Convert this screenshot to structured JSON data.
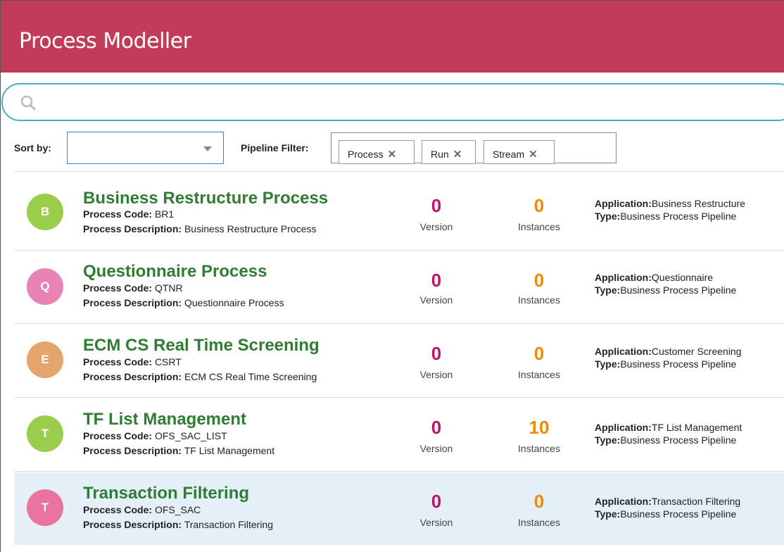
{
  "header": {
    "title": "Process Modeller"
  },
  "search": {
    "placeholder": "",
    "icon": "search-icon"
  },
  "sort": {
    "label": "Sort by:",
    "value": ""
  },
  "pipeline_filter": {
    "label": "Pipeline Filter:",
    "chips": [
      {
        "label": "Process",
        "remove": "✕"
      },
      {
        "label": "Run",
        "remove": "✕"
      },
      {
        "label": "Stream",
        "remove": "✕"
      }
    ]
  },
  "labels": {
    "process_code": "Process Code:",
    "process_description": "Process Description:",
    "version": "Version",
    "instances": "Instances",
    "application": "Application:",
    "type": "Type:"
  },
  "processes": [
    {
      "initial": "B",
      "avatar_color": "#9acd4c",
      "name": "Business Restructure Process",
      "code": "BR1",
      "description": "Business Restructure Process",
      "version": "0",
      "instances": "0",
      "application": "Business Restructure",
      "type": "Business Process Pipeline",
      "selected": false
    },
    {
      "initial": "Q",
      "avatar_color": "#e883b4",
      "name": "Questionnaire Process",
      "code": "QTNR",
      "description": "Questionnaire Process",
      "version": "0",
      "instances": "0",
      "application": "Questionnaire",
      "type": "Business Process Pipeline",
      "selected": false
    },
    {
      "initial": "E",
      "avatar_color": "#e3a56b",
      "name": "ECM CS Real Time Screening",
      "code": "CSRT",
      "description": "ECM CS Real Time Screening",
      "version": "0",
      "instances": "0",
      "application": "Customer Screening",
      "type": "Business Process Pipeline",
      "selected": false
    },
    {
      "initial": "T",
      "avatar_color": "#9acd4c",
      "name": "TF List Management",
      "code": "OFS_SAC_LIST",
      "description": "TF List Management",
      "version": "0",
      "instances": "10",
      "application": "TF List Management",
      "type": "Business Process Pipeline",
      "selected": false
    },
    {
      "initial": "T",
      "avatar_color": "#e8749e",
      "name": "Transaction Filtering",
      "code": "OFS_SAC",
      "description": "Transaction Filtering",
      "version": "0",
      "instances": "0",
      "application": "Transaction Filtering",
      "type": "Business Process Pipeline",
      "selected": true
    }
  ]
}
